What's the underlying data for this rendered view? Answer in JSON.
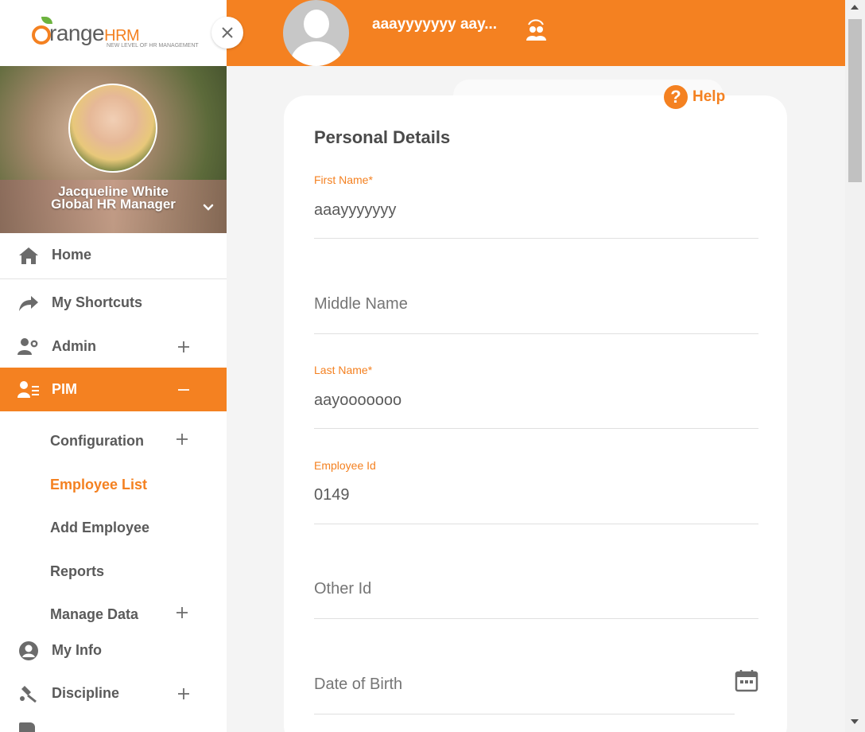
{
  "brand": {
    "name_part1": "range",
    "name_part2": "HRM",
    "tagline": "NEW LEVEL OF HR MANAGEMENT"
  },
  "profile": {
    "name": "Jacqueline White",
    "role": "Global HR Manager"
  },
  "topbar": {
    "employee_name": "aaayyyyyyy aay..."
  },
  "menu": {
    "home": "Home",
    "shortcuts": "My Shortcuts",
    "admin": "Admin",
    "pim": "PIM",
    "my_info": "My Info",
    "discipline": "Discipline"
  },
  "pim_submenu": {
    "configuration": "Configuration",
    "employee_list": "Employee List",
    "add_employee": "Add Employee",
    "reports": "Reports",
    "manage_data": "Manage Data"
  },
  "help": {
    "label": "Help",
    "symbol": "?"
  },
  "form": {
    "title": "Personal Details",
    "first_name": {
      "label": "First Name",
      "required_mark": "*",
      "value": "aaayyyyyyy"
    },
    "middle_name": {
      "placeholder": "Middle Name"
    },
    "last_name": {
      "label": "Last Name",
      "required_mark": "*",
      "value": "aayooooooo"
    },
    "employee_id": {
      "label": "Employee Id",
      "value": "0149"
    },
    "other_id": {
      "placeholder": "Other Id"
    },
    "date_of_birth": {
      "placeholder": "Date of Birth"
    }
  },
  "colors": {
    "accent": "#f48121",
    "text": "#5a5a5a"
  }
}
